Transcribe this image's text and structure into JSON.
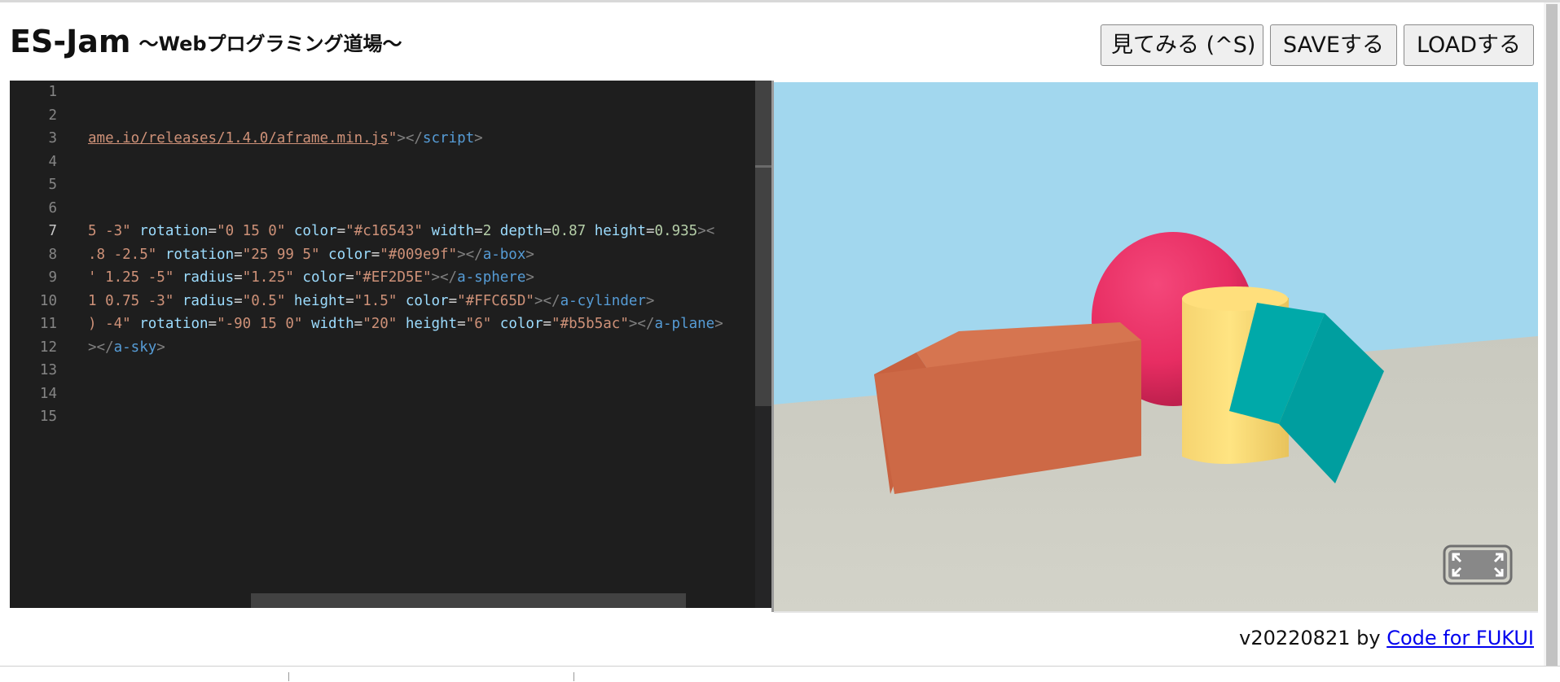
{
  "header": {
    "title": "ES-Jam",
    "subtitle": "～Webプログラミング道場～",
    "buttons": {
      "view": "見てみる (^S)",
      "save": "SAVEする",
      "load": "LOADする"
    }
  },
  "editor": {
    "line_numbers": [
      "1",
      "2",
      "3",
      "4",
      "5",
      "6",
      "7",
      "8",
      "9",
      "10",
      "11",
      "12",
      "13",
      "14",
      "15"
    ],
    "active_line": "7",
    "lines": {
      "l3": {
        "url": "ame.io/releases/1.4.0/aframe.min.js",
        "q": "\"",
        "close_open": "></",
        "tag": "script",
        "end": ">"
      },
      "l7": {
        "pos_val": "5 -3\"",
        "rot_attr": " rotation",
        "rot_val": "\"0 15 0\"",
        "color_attr": " color",
        "color_val": "\"#c16543\"",
        "w_attr": " width",
        "w_val": "2",
        "d_attr": " depth",
        "d_val": "0.87",
        "h_attr": " height",
        "h_val": "0.935",
        "tail": "><"
      },
      "l8": {
        "pos_val": ".8 -2.5\"",
        "rot_attr": " rotation",
        "rot_val": "\"25 99 5\"",
        "color_attr": " color",
        "color_val": "\"#009e9f\"",
        "close_open": "></",
        "tag": "a-box",
        "end": ">"
      },
      "l9": {
        "pos_val": "' 1.25 -5\"",
        "r_attr": " radius",
        "r_val": "\"1.25\"",
        "color_attr": " color",
        "color_val": "\"#EF2D5E\"",
        "close_open": "></",
        "tag": "a-sphere",
        "end": ">"
      },
      "l10": {
        "pos_val": "1 0.75 -3\"",
        "r_attr": " radius",
        "r_val": "\"0.5\"",
        "h_attr": " height",
        "h_val": "\"1.5\"",
        "color_attr": " color",
        "color_val": "\"#FFC65D\"",
        "close_open": "></",
        "tag": "a-cylinder",
        "end": ">"
      },
      "l11": {
        "pos_val": ") -4\"",
        "rot_attr": " rotation",
        "rot_val": "\"-90 15 0\"",
        "w_attr": " width",
        "w_val": "\"20\"",
        "h_attr": " height",
        "h_val": "\"6\"",
        "color_attr": " color",
        "color_val": "\"#b5b5ac\"",
        "close_open": "></",
        "tag": "a-plane",
        "end": ">"
      },
      "l12": {
        "close_open": "></",
        "tag": "a-sky",
        "end": ">"
      }
    },
    "eq": "="
  },
  "scene": {
    "colors": {
      "sky": "#a2d7ee",
      "ground": "#cfcfc5",
      "box_orange": "#c16543",
      "box_teal": "#009e9f",
      "sphere": "#EF2D5E",
      "cylinder": "#FFC65D"
    },
    "fullscreen_icon": "enter-fullscreen-icon"
  },
  "footer": {
    "version_text": "v20220821 by ",
    "link_text": "Code for FUKUI"
  }
}
